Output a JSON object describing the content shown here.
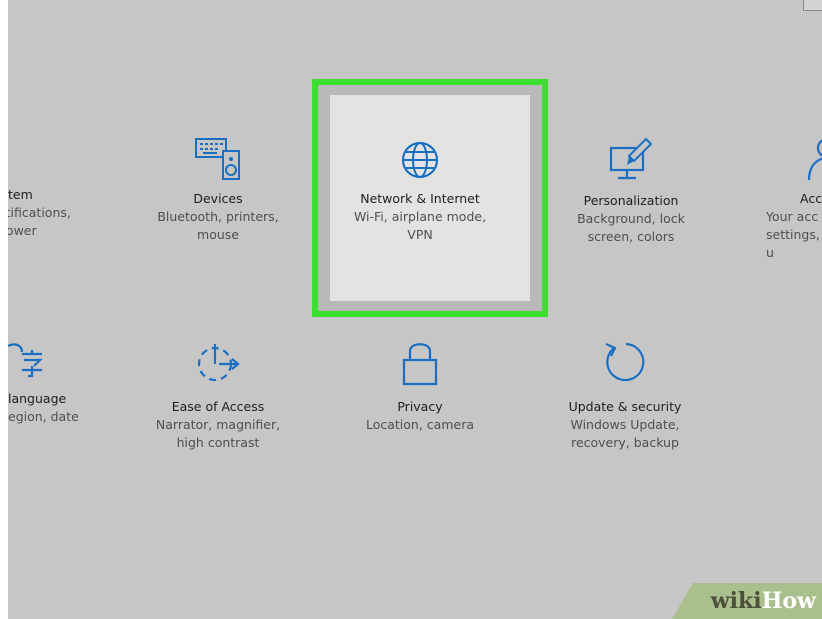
{
  "tiles": {
    "system": {
      "title": "tem",
      "desc": "otifications, power"
    },
    "devices": {
      "title": "Devices",
      "desc": "Bluetooth, printers, mouse"
    },
    "network": {
      "title": "Network & Internet",
      "desc": "Wi-Fi, airplane mode, VPN"
    },
    "personalization": {
      "title": "Personalization",
      "desc": "Background, lock screen, colors"
    },
    "accounts": {
      "title": "Acc",
      "desc": "Your acc settings, u"
    },
    "time_language": {
      "title": "language",
      "desc": "egion, date"
    },
    "ease_of_access": {
      "title": "Ease of Access",
      "desc": "Narrator, magnifier, high contrast"
    },
    "privacy": {
      "title": "Privacy",
      "desc": "Location, camera"
    },
    "update_security": {
      "title": "Update & security",
      "desc": "Windows Update, recovery, backup"
    }
  },
  "watermark": {
    "wiki": "wiki",
    "how": "How"
  },
  "colors": {
    "icon_blue": "#1a6fc4",
    "highlight_green": "#3ede30",
    "background": "#c6c6c6"
  },
  "icons": {
    "system": "laptop-icon",
    "devices": "keyboard-speaker-icon",
    "network": "globe-icon",
    "personalization": "monitor-brush-icon",
    "accounts": "person-icon",
    "time_language": "language-character-icon",
    "ease_of_access": "ease-of-access-icon",
    "privacy": "padlock-icon",
    "update_security": "refresh-arrow-icon"
  }
}
